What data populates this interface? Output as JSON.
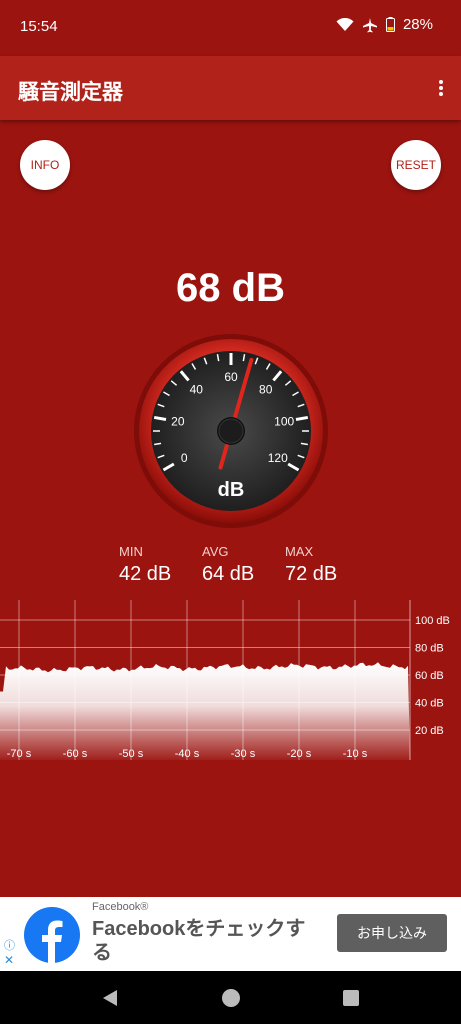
{
  "status_bar": {
    "time": "15:54",
    "battery": "28%"
  },
  "app": {
    "title": "騒音測定器"
  },
  "buttons": {
    "info": "INFO",
    "reset": "RESET"
  },
  "meter": {
    "reading": "68 dB",
    "unit": "dB",
    "value": 68,
    "scale_labels": [
      "0",
      "20",
      "40",
      "60",
      "80",
      "100",
      "120"
    ]
  },
  "stats": [
    {
      "label": "MIN",
      "value": "42 dB"
    },
    {
      "label": "AVG",
      "value": "64 dB"
    },
    {
      "label": "MAX",
      "value": "72 dB"
    }
  ],
  "history": {
    "y_labels": [
      "100 dB",
      "80 dB",
      "60 dB",
      "40 dB",
      "20 dB"
    ],
    "x_labels": [
      "-70 s",
      "-60 s",
      "-50 s",
      "-40 s",
      "-30 s",
      "-20 s",
      "-10 s"
    ],
    "level_db": 64
  },
  "ad": {
    "sponsor": "Facebook®",
    "headline": "Facebookをチェックする",
    "cta": "お申し込み"
  },
  "colors": {
    "primary": "#b1221a",
    "background": "#9b1410"
  }
}
